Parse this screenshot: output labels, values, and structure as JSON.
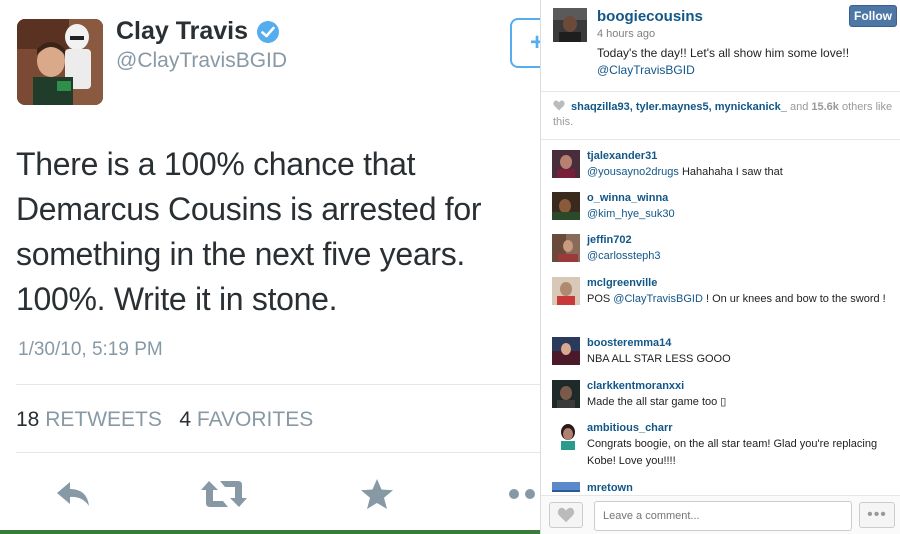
{
  "tweet": {
    "name": "Clay Travis",
    "handle": "@ClayTravisBGID",
    "text": "There is a 100% chance that Demarcus Cousins is arrested for something in the next five years. 100%. Write it in stone.",
    "timestamp": "1/30/10, 5:19 PM",
    "retweets_count": "18",
    "retweets_label": "RETWEETS",
    "favorites_count": "4",
    "favorites_label": "FAVORITES",
    "follow_glyph": "+",
    "accent_color": "#55acee"
  },
  "instagram": {
    "username": "boogiecousins",
    "time_ago": "4 hours ago",
    "caption": "Today's the day!! Let's all show him some love!!",
    "caption_mention": "@ClayTravisBGID",
    "follow_label": "Follow",
    "likes": {
      "users": [
        "shaqzilla93,",
        "tyler.maynes5,",
        "mynickanick_"
      ],
      "and": "and",
      "count": "15.6k",
      "suffix": "others like this."
    },
    "comments": [
      {
        "user": "tjalexander31",
        "mention": "@yousayno2drugs",
        "text": " Hahahaha I saw that"
      },
      {
        "user": "o_winna_winna",
        "mention": "@kim_hye_suk30",
        "text": ""
      },
      {
        "user": "jeffin702",
        "mention": "@carlossteph3",
        "text": ""
      },
      {
        "user": "mclgreenville",
        "prefix": "POS ",
        "mention": "@ClayTravisBGID",
        "text": " ! On ur knees and bow to the sword !"
      },
      {
        "user": "boosteremma14",
        "text": "NBA ALL STAR LESS GOOO"
      },
      {
        "user": "clarkkentmoranxxi",
        "text": "Made the all star game too ▯"
      },
      {
        "user": "ambitious_charr",
        "text": "Congrats boogie, on the all star team! Glad you're replacing Kobe! Love you!!!!"
      },
      {
        "user": "mretown",
        "text": ""
      }
    ],
    "comment_placeholder": "Leave a comment...",
    "more_glyph": "•••",
    "brand_color": "#125688"
  }
}
